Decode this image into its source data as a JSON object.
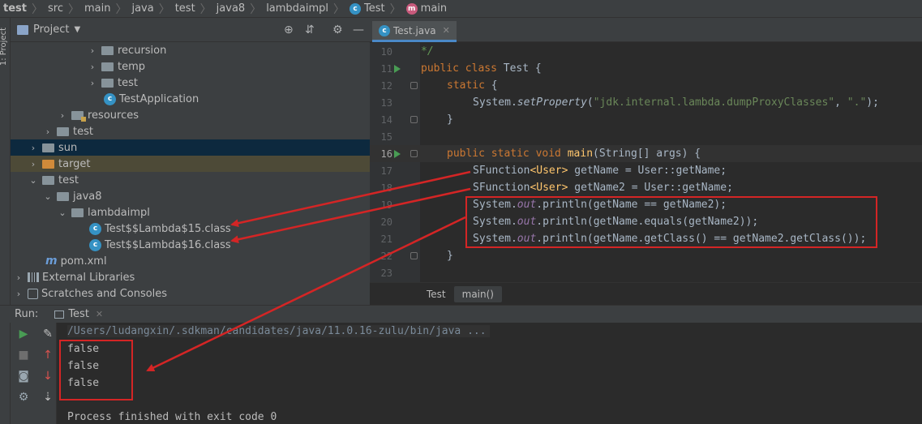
{
  "breadcrumb": [
    "test",
    "src",
    "main",
    "java",
    "test",
    "java8",
    "lambdaimpl",
    "Test",
    "main"
  ],
  "left_stripe_label": "1: Project",
  "project_panel": {
    "title": "Project",
    "tree": [
      {
        "label": "recursion",
        "kind": "package",
        "expanded": false
      },
      {
        "label": "temp",
        "kind": "package",
        "expanded": false
      },
      {
        "label": "test",
        "kind": "package",
        "expanded": false
      },
      {
        "label": "TestApplication",
        "kind": "class"
      },
      {
        "label": "resources",
        "kind": "resources",
        "expanded": false
      },
      {
        "label": "test",
        "kind": "folder",
        "expanded": false
      },
      {
        "label": "sun",
        "kind": "folder",
        "expanded": false
      },
      {
        "label": "target",
        "kind": "folder-excluded",
        "expanded": false
      },
      {
        "label": "test",
        "kind": "folder",
        "expanded": true
      },
      {
        "label": "java8",
        "kind": "folder",
        "expanded": true
      },
      {
        "label": "lambdaimpl",
        "kind": "folder",
        "expanded": true
      },
      {
        "label": "Test$$Lambda$15.class",
        "kind": "class"
      },
      {
        "label": "Test$$Lambda$16.class",
        "kind": "class"
      },
      {
        "label": "pom.xml",
        "kind": "maven"
      },
      {
        "label": "External Libraries",
        "kind": "libraries",
        "expanded": false
      },
      {
        "label": "Scratches and Consoles",
        "kind": "scratches",
        "expanded": false
      }
    ]
  },
  "editor": {
    "tab_label": "Test.java",
    "lines": [
      {
        "n": "10"
      },
      {
        "n": "11"
      },
      {
        "n": "12"
      },
      {
        "n": "13"
      },
      {
        "n": "14"
      },
      {
        "n": "15"
      },
      {
        "n": "16"
      },
      {
        "n": "17"
      },
      {
        "n": "18"
      },
      {
        "n": "19"
      },
      {
        "n": "20"
      },
      {
        "n": "21"
      },
      {
        "n": "22"
      },
      {
        "n": "23"
      }
    ],
    "code": {
      "l10": "*/",
      "l11_kw": "public class ",
      "l11_name": "Test {",
      "l12_kw": "static ",
      "l12_rest": "{",
      "l13_a": "System.",
      "l13_m": "setProperty",
      "l13_b": "(",
      "l13_s1": "\"jdk.internal.lambda.dumpProxyClasses\"",
      "l13_c": ", ",
      "l13_s2": "\".\"",
      "l13_d": ");",
      "l14": "}",
      "l16_kw": "public static void ",
      "l16_m": "main",
      "l16_rest": "(String[] args) {",
      "l17_a": "SFunction",
      "l17_g": "<User>",
      "l17_b": " getName = User::getName;",
      "l18_a": "SFunction",
      "l18_g": "<User>",
      "l18_b": " getName2 = User::getName;",
      "l19_a": "System.",
      "l19_f": "out",
      "l19_b": ".println(getName == getName2);",
      "l20_a": "System.",
      "l20_f": "out",
      "l20_b": ".println(getName.equals(getName2));",
      "l21_a": "System.",
      "l21_f": "out",
      "l21_b": ".println(getName.getClass() == getName2.getClass());",
      "l22": "}"
    },
    "breadcrumb": [
      "Test",
      "main()"
    ]
  },
  "run_panel": {
    "label": "Run:",
    "tab_label": "Test",
    "command": "/Users/ludangxin/.sdkman/candidates/java/11.0.16-zulu/bin/java ...",
    "output": [
      "false",
      "false",
      "false"
    ],
    "exit_message": "Process finished with exit code 0"
  },
  "colors": {
    "annotation": "#d42525",
    "keyword": "#cc7832",
    "string": "#6a8759",
    "static_field": "#9876aa"
  }
}
